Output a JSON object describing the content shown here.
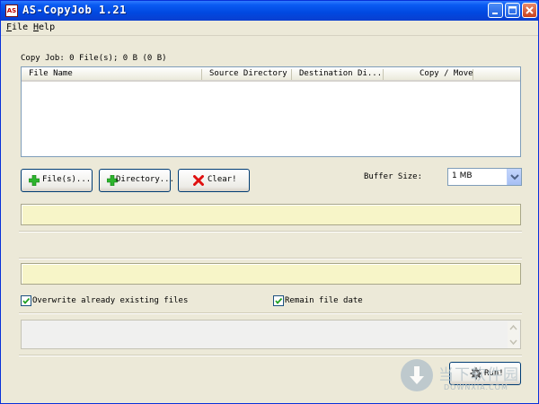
{
  "window": {
    "title": "AS-CopyJob 1.21",
    "app_icon": "AS"
  },
  "menu": {
    "file": "File",
    "help": "Help"
  },
  "summary": "Copy Job: 0 File(s); 0 B (0 B)",
  "list": {
    "columns": [
      "File Name",
      "Source Directory",
      "Destination Di...",
      "Copy / Move"
    ],
    "rows": []
  },
  "buttons": {
    "files": "File(s)...",
    "directory": "Directory...",
    "clear": "Clear!",
    "run": "Run!"
  },
  "buffer": {
    "label": "Buffer Size:",
    "value": "1 MB"
  },
  "options": {
    "overwrite": {
      "label": "Overwrite already existing files",
      "checked": true
    },
    "remain_date": {
      "label": "Remain file date",
      "checked": true
    }
  },
  "watermark": {
    "text": "当下软件园",
    "sub": "DOWNXIA.COM"
  },
  "colors": {
    "titlebar": "#0a5bf2",
    "window_bg": "#ece9d8",
    "progress_fill": "#f7f5c8",
    "add_icon": "#2db52d",
    "clear_icon": "#e01010"
  },
  "icons": {
    "files_button": "green-plus-icon",
    "directory_button": "green-plus-icon",
    "clear_button": "red-x-icon",
    "run_button": "gear-icon"
  }
}
